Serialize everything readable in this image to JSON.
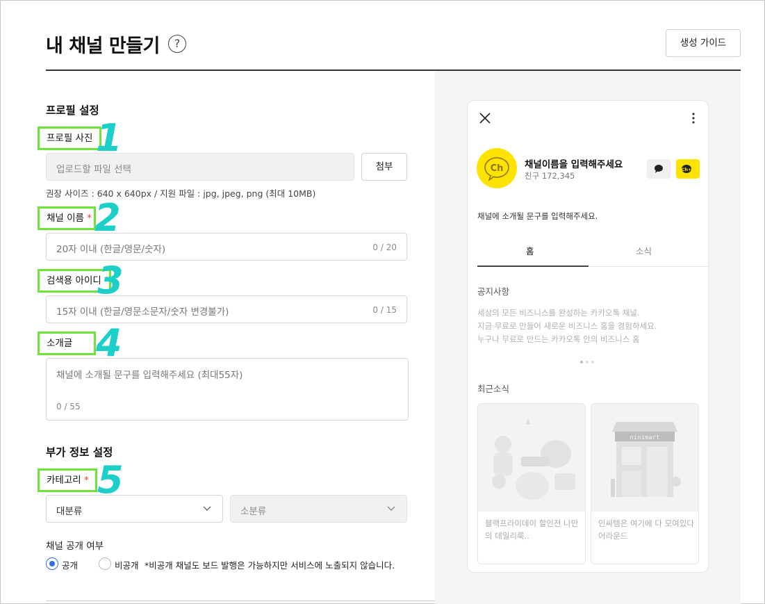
{
  "header": {
    "title": "내 채널 만들기",
    "help_symbol": "?",
    "guide_button": "생성 가이드"
  },
  "profile": {
    "section_title": "프로필 설정",
    "photo_label": "프로필 사진",
    "photo_placeholder": "업로드할 파일 선택",
    "attach_button": "첨부",
    "photo_hint": "권장 사이즈 : 640 x 640px / 지원 파일 : jpg, jpeg, png (최대 10MB)",
    "name_label": "채널 이름",
    "name_placeholder": "20자 이내 (한글/영문/숫자)",
    "name_counter": "0 / 20",
    "search_id_label": "검색용 아이디",
    "search_id_placeholder": "15자 이내 (한글/영문소문자/숫자 변경불가)",
    "search_id_counter": "0 / 15",
    "intro_label": "소개글",
    "intro_placeholder": "채널에 소개될 문구를 입력해주세요 (최대55자)",
    "intro_counter": "0 / 55",
    "required_mark": "*"
  },
  "annotations": [
    "1",
    "2",
    "3",
    "4",
    "5"
  ],
  "extra": {
    "section_title": "부가 정보 설정",
    "category_label": "카테고리",
    "major_select": "대분류",
    "minor_select": "소분류",
    "visibility_label": "채널 공개 여부",
    "public_label": "공개",
    "private_label": "비공개",
    "private_note": "*비공개 채널도 보드 발행은 가능하지만 서비스에 노출되지 않습니다."
  },
  "preview": {
    "logo_text": "Ch",
    "channel_name": "채널이름을 입력해주세요",
    "friends": "친구 172,345",
    "add_badge": "Ch+",
    "intro": "채널에 소개될 문구를 입력해주세요.",
    "tab_home": "홈",
    "tab_news": "소식",
    "notice_title": "공지사항",
    "notice_lines": [
      "세상의 모든 비즈니스를 완성하는 카카오톡 채널.",
      "지금 무료로 만들어 새로운 비즈니스 홈을 경험하세요.",
      "누구나 무료로 만드는 카카오톡 안의 비즈니스 홈"
    ],
    "recent_title": "최근소식",
    "cards": [
      {
        "caption": "블랙프라이데이 할인전 나만의 데일리룩.."
      },
      {
        "caption": "인싸템은 여기에 다 모여있다 어라운드",
        "sign": "ninimart"
      }
    ]
  },
  "colors": {
    "annotation_box": "#6ee33a",
    "annotation_number": "#1ccfc9",
    "kakao_yellow": "#ffe300",
    "radio_blue": "#2f6fe5"
  }
}
